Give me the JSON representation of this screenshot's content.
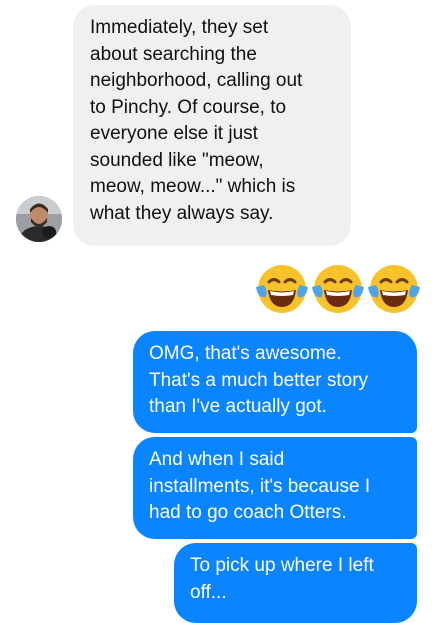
{
  "conversation": {
    "messages": [
      {
        "direction": "incoming",
        "text": "Immediately, they set\nabout searching the\nneighborhood, calling out\nto Pinchy.  Of course, to\neveryone else it just\nsounded like \"meow,\nmeow, meow...\" which is\nwhat they always say."
      },
      {
        "direction": "outgoing",
        "type": "emoji",
        "emoji": [
          "face-with-tears-of-joy",
          "face-with-tears-of-joy",
          "face-with-tears-of-joy"
        ]
      },
      {
        "direction": "outgoing",
        "text": "OMG, that's awesome.\nThat's a much better story\nthan I've actually got."
      },
      {
        "direction": "outgoing",
        "text": "And when I said\ninstallments, it's because I\nhad to go coach Otters."
      },
      {
        "direction": "outgoing",
        "text": "To pick up where I left\noff..."
      }
    ]
  },
  "colors": {
    "incoming_bubble": "#f1f0f0",
    "outgoing_bubble": "#0a84ff",
    "background": "#ffffff"
  }
}
